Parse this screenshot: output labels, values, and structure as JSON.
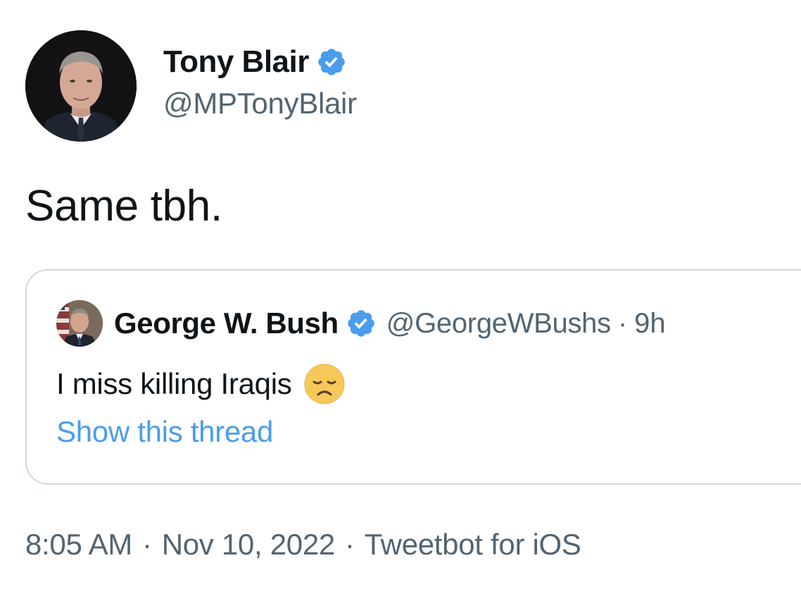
{
  "tweet": {
    "author": {
      "display_name": "Tony Blair",
      "handle": "@MPTonyBlair",
      "verified": true,
      "avatar_icon": "avatar-photo"
    },
    "text": "Same tbh.",
    "timestamp": {
      "time": "8:05 AM",
      "separator": "·",
      "date": "Nov 10, 2022",
      "source": "Tweetbot for iOS"
    }
  },
  "quoted_tweet": {
    "author": {
      "display_name": "George W. Bush",
      "handle": "@GeorgeWBushs",
      "verified": true,
      "avatar_icon": "avatar-photo"
    },
    "separator": "·",
    "age": "9h",
    "text": "I miss killing Iraqis",
    "emoji": "disappointed-face-emoji",
    "show_thread_label": "Show this thread"
  },
  "colors": {
    "text_primary": "#0f1419",
    "text_secondary": "#536471",
    "link": "#4a9ded",
    "verified": "#4a9ded",
    "card_border": "#cfd9de"
  }
}
